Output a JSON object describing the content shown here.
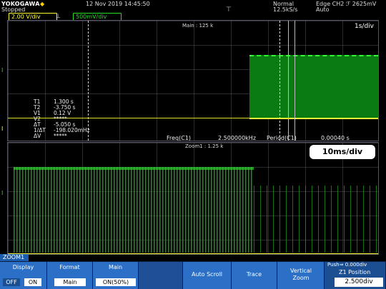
{
  "header": {
    "brand": "YOKOGAWA",
    "state": "Stopped",
    "date": "12 Nov 2019 14:45:50",
    "mode": "Normal",
    "sample_rate": "12.5kS/s",
    "trigger": "Edge CH2 ℱ 2625mV",
    "trigger_mode": "Auto"
  },
  "channels": [
    {
      "label": "2.00 V/div",
      "color": "#ffff33"
    },
    {
      "label": "500mV/div",
      "color": "#22dd22"
    }
  ],
  "main_window": {
    "label": "Main : 125 k",
    "time_div": "1s/div"
  },
  "measurements": [
    {
      "key": "T1",
      "value": "1.300 s"
    },
    {
      "key": "T2",
      "value": "-3.750 s"
    },
    {
      "key": "V1",
      "value": "0.12 V"
    },
    {
      "key": "V2",
      "value": "*****"
    },
    {
      "key": "ΔT",
      "value": "-5.050 s"
    },
    {
      "key": "1/ΔT",
      "value": "-198.020mHz"
    },
    {
      "key": "ΔV",
      "value": "*****"
    }
  ],
  "freq": {
    "label": "Freq(C1)",
    "value": "2.500000kHz"
  },
  "period": {
    "label": "Period(C1)",
    "value": "0.00040 s"
  },
  "zoom_window": {
    "label": "Zoom1 : 1.25 k",
    "badge": "10ms/div"
  },
  "bottom": {
    "zoom_tab": "ZOOM1",
    "display": {
      "title": "Display",
      "off": "OFF",
      "on": "ON"
    },
    "format": {
      "title": "Format",
      "value": "Main"
    },
    "main": {
      "title": "Main",
      "value": "ON(50%)"
    },
    "autoscroll": {
      "title": "Auto Scroll"
    },
    "trace": {
      "title": "Trace"
    },
    "vzoom": {
      "title": "Vertical Zoom"
    },
    "position": {
      "push": "Push⇒ 0.000div",
      "title": "Z1 Position",
      "value": "2.500div"
    }
  }
}
